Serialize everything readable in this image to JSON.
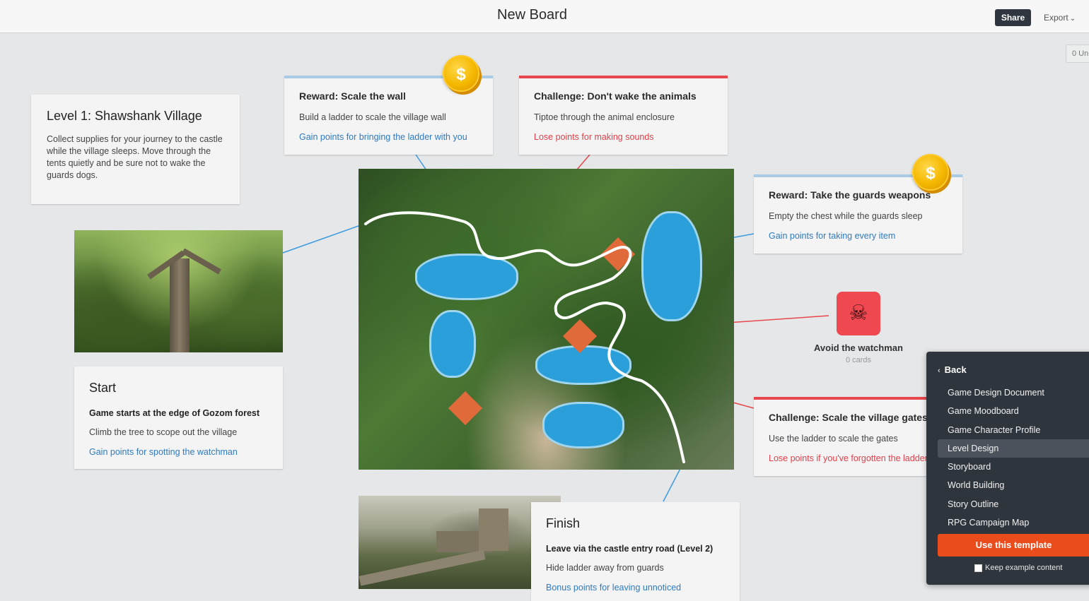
{
  "header": {
    "board_title": "New Board",
    "share_label": "Share",
    "export_label": "Export",
    "unsorted_label": "0 Un"
  },
  "cards": {
    "level1": {
      "title": "Level 1: Shawshank Village",
      "text": "Collect supplies for your journey to the castle while the village sleeps. Move through the tents quietly and be sure not to wake the guards dogs."
    },
    "reward_wall": {
      "title": "Reward: Scale the wall",
      "text": "Build a ladder to scale the village wall",
      "link": "Gain points for bringing the ladder with you"
    },
    "challenge_animals": {
      "title": "Challenge: Don't wake the animals",
      "text": "Tiptoe through the animal enclosure",
      "link": "Lose points for making sounds"
    },
    "reward_weapons": {
      "title": "Reward: Take the guards weapons",
      "text": "Empty the chest while the guards sleep",
      "link": "Gain points for taking every item"
    },
    "start": {
      "title": "Start",
      "bold": "Game starts at the edge of Gozom forest",
      "text": "Climb the tree to scope out the village",
      "link": "Gain points for spotting the watchman"
    },
    "challenge_gates": {
      "title": "Challenge: Scale the village gates",
      "text": "Use the ladder to scale the gates",
      "link": "Lose points if you've forgotten the ladder"
    },
    "finish": {
      "title": "Finish",
      "bold": "Leave via the castle entry road (Level  2)",
      "text": "Hide ladder away from guards",
      "link": "Bonus points for leaving unnoticed"
    }
  },
  "coin_symbol": "$",
  "skull_symbol": "☠",
  "watchman": {
    "label": "Avoid the watchman",
    "count": "0 cards"
  },
  "template_panel": {
    "back_label": "Back",
    "items": [
      "Game Design Document",
      "Game Moodboard",
      "Game Character Profile",
      "Level Design",
      "Storyboard",
      "World Building",
      "Story Outline",
      "RPG Campaign Map"
    ],
    "selected": "Level Design",
    "use_button": "Use this template",
    "keep_label": "Keep example content"
  },
  "colors": {
    "accent_orange": "#ea4c1c",
    "reward_blue": "#a9cbe6",
    "challenge_red": "#e7474d",
    "link_blue": "#2f7abf",
    "link_red": "#e0404a",
    "panel_dark": "#2f353d"
  }
}
